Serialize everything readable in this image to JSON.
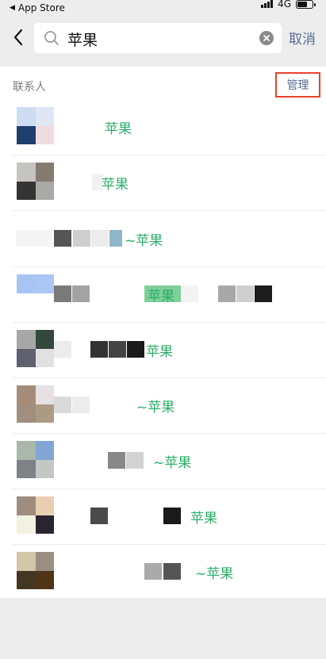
{
  "status_bar": {
    "back_label": "App Store",
    "network": "4G"
  },
  "search": {
    "query": "苹果",
    "cancel_label": "取消"
  },
  "section": {
    "title": "联系人",
    "manage_label": "管理"
  },
  "contacts": [
    {
      "name": "苹果",
      "avatar": [
        "#cddcf0",
        "#dfe7f4",
        "#1e3e6e",
        "#f0dcdf"
      ]
    },
    {
      "name": "苹果",
      "avatar": [
        "#c6c4c0",
        "#857b6f",
        "#353433",
        "#a9aaa8"
      ]
    },
    {
      "name": "~苹果",
      "avatar": [
        "#ffffff",
        "#ffffff",
        "#ffffff",
        "#ffffff"
      ]
    },
    {
      "name": "苹果",
      "avatar": [
        "#a8c4f3",
        "#aac7f4",
        "#ffffff",
        "#ffffff"
      ]
    },
    {
      "name": "苹果",
      "avatar": [
        "#a7a7a7",
        "#34493e",
        "#5f6170",
        "#e1e1e4"
      ]
    },
    {
      "name": "~苹果",
      "avatar": [
        "#a48c78",
        "#e7e1e3",
        "#a08f7e",
        "#ac9a84"
      ]
    },
    {
      "name": "~苹果",
      "avatar": [
        "#a9b8a9",
        "#82a6d4",
        "#7c8285",
        "#c4c8c2"
      ]
    },
    {
      "name": "苹果",
      "avatar": [
        "#9e8d7f",
        "#e9cfb2",
        "#f3f2e1",
        "#2a2330"
      ]
    },
    {
      "name": "~苹果",
      "avatar": [
        "#d3c7a9",
        "#9a8f82",
        "#433622",
        "#4f3417"
      ]
    }
  ],
  "colors": {
    "link_blue": "#576b95",
    "match_green": "#2aae67",
    "highlight_red": "#e8412f",
    "background": "#ededed"
  },
  "icons": {
    "back": "chevron-left-icon",
    "search": "search-icon",
    "clear": "clear-icon"
  }
}
